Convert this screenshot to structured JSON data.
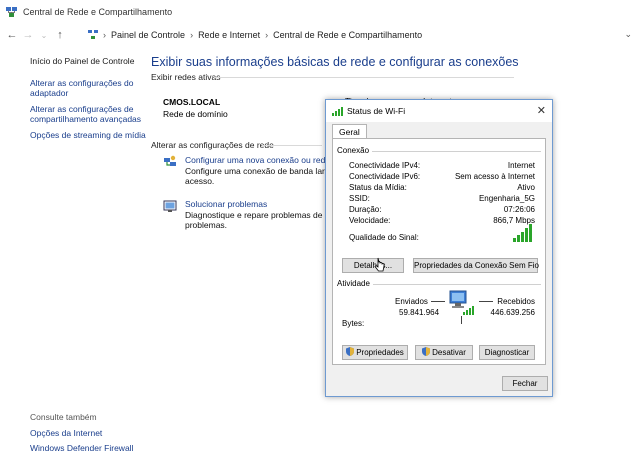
{
  "window": {
    "title": "Central de Rede e Compartilhamento"
  },
  "address": {
    "crumbs": [
      "Painel de Controle",
      "Rede e Internet",
      "Central de Rede e Compartilhamento"
    ]
  },
  "left": {
    "home": "Início do Painel de Controle",
    "links": [
      "Alterar as configurações do adaptador",
      "Alterar as configurações de compartilhamento avançadas",
      "Opções de streaming de mídia"
    ],
    "see_also": "Consulte também",
    "bottom_links": [
      "Opções da Internet",
      "Windows Defender Firewall"
    ]
  },
  "main": {
    "title": "Exibir suas informações básicas de rede e configurar as conexões",
    "active_label": "Exibir redes ativas",
    "network_name": "CMOS.LOCAL",
    "network_type": "Rede de domínio",
    "access_label": "Tipo de acesso:",
    "access_value": "Internet",
    "change_label": "Alterar as configurações de rede",
    "tasks": [
      {
        "link": "Configurar uma nova conexão ou rede",
        "desc": "Configure uma conexão de banda larga, di acesso."
      },
      {
        "link": "Solucionar problemas",
        "desc": "Diagnostique e repare problemas de rede o problemas."
      }
    ]
  },
  "dialog": {
    "title": "Status de Wi-Fi",
    "close": "✕",
    "tab": "Geral",
    "connection_label": "Conexão",
    "rows": [
      {
        "label": "Conectividade IPv4:",
        "value": "Internet"
      },
      {
        "label": "Conectividade IPv6:",
        "value": "Sem acesso à Internet"
      },
      {
        "label": "Status da Mídia:",
        "value": "Ativo"
      },
      {
        "label": "SSID:",
        "value": "Engenharia_5G"
      },
      {
        "label": "Duração:",
        "value": "07:26:06"
      },
      {
        "label": "Velocidade:",
        "value": "866,7 Mbps"
      }
    ],
    "signal_label": "Qualidade do Sinal:",
    "details_btn": "Detalhes...",
    "props_wifi_btn": "Propriedades da Conexão Sem Fio",
    "activity_label": "Atividade",
    "sent_label": "Enviados",
    "received_label": "Recebidos",
    "bytes_label": "Bytes:",
    "sent_value": "59.841.964",
    "received_value": "446.639.256",
    "properties_btn": "Propriedades",
    "disable_btn": "Desativar",
    "diagnose_btn": "Diagnosticar",
    "close_btn": "Fechar"
  },
  "colors": {
    "link": "#1a3e8c",
    "signal": "#2aa52a"
  }
}
